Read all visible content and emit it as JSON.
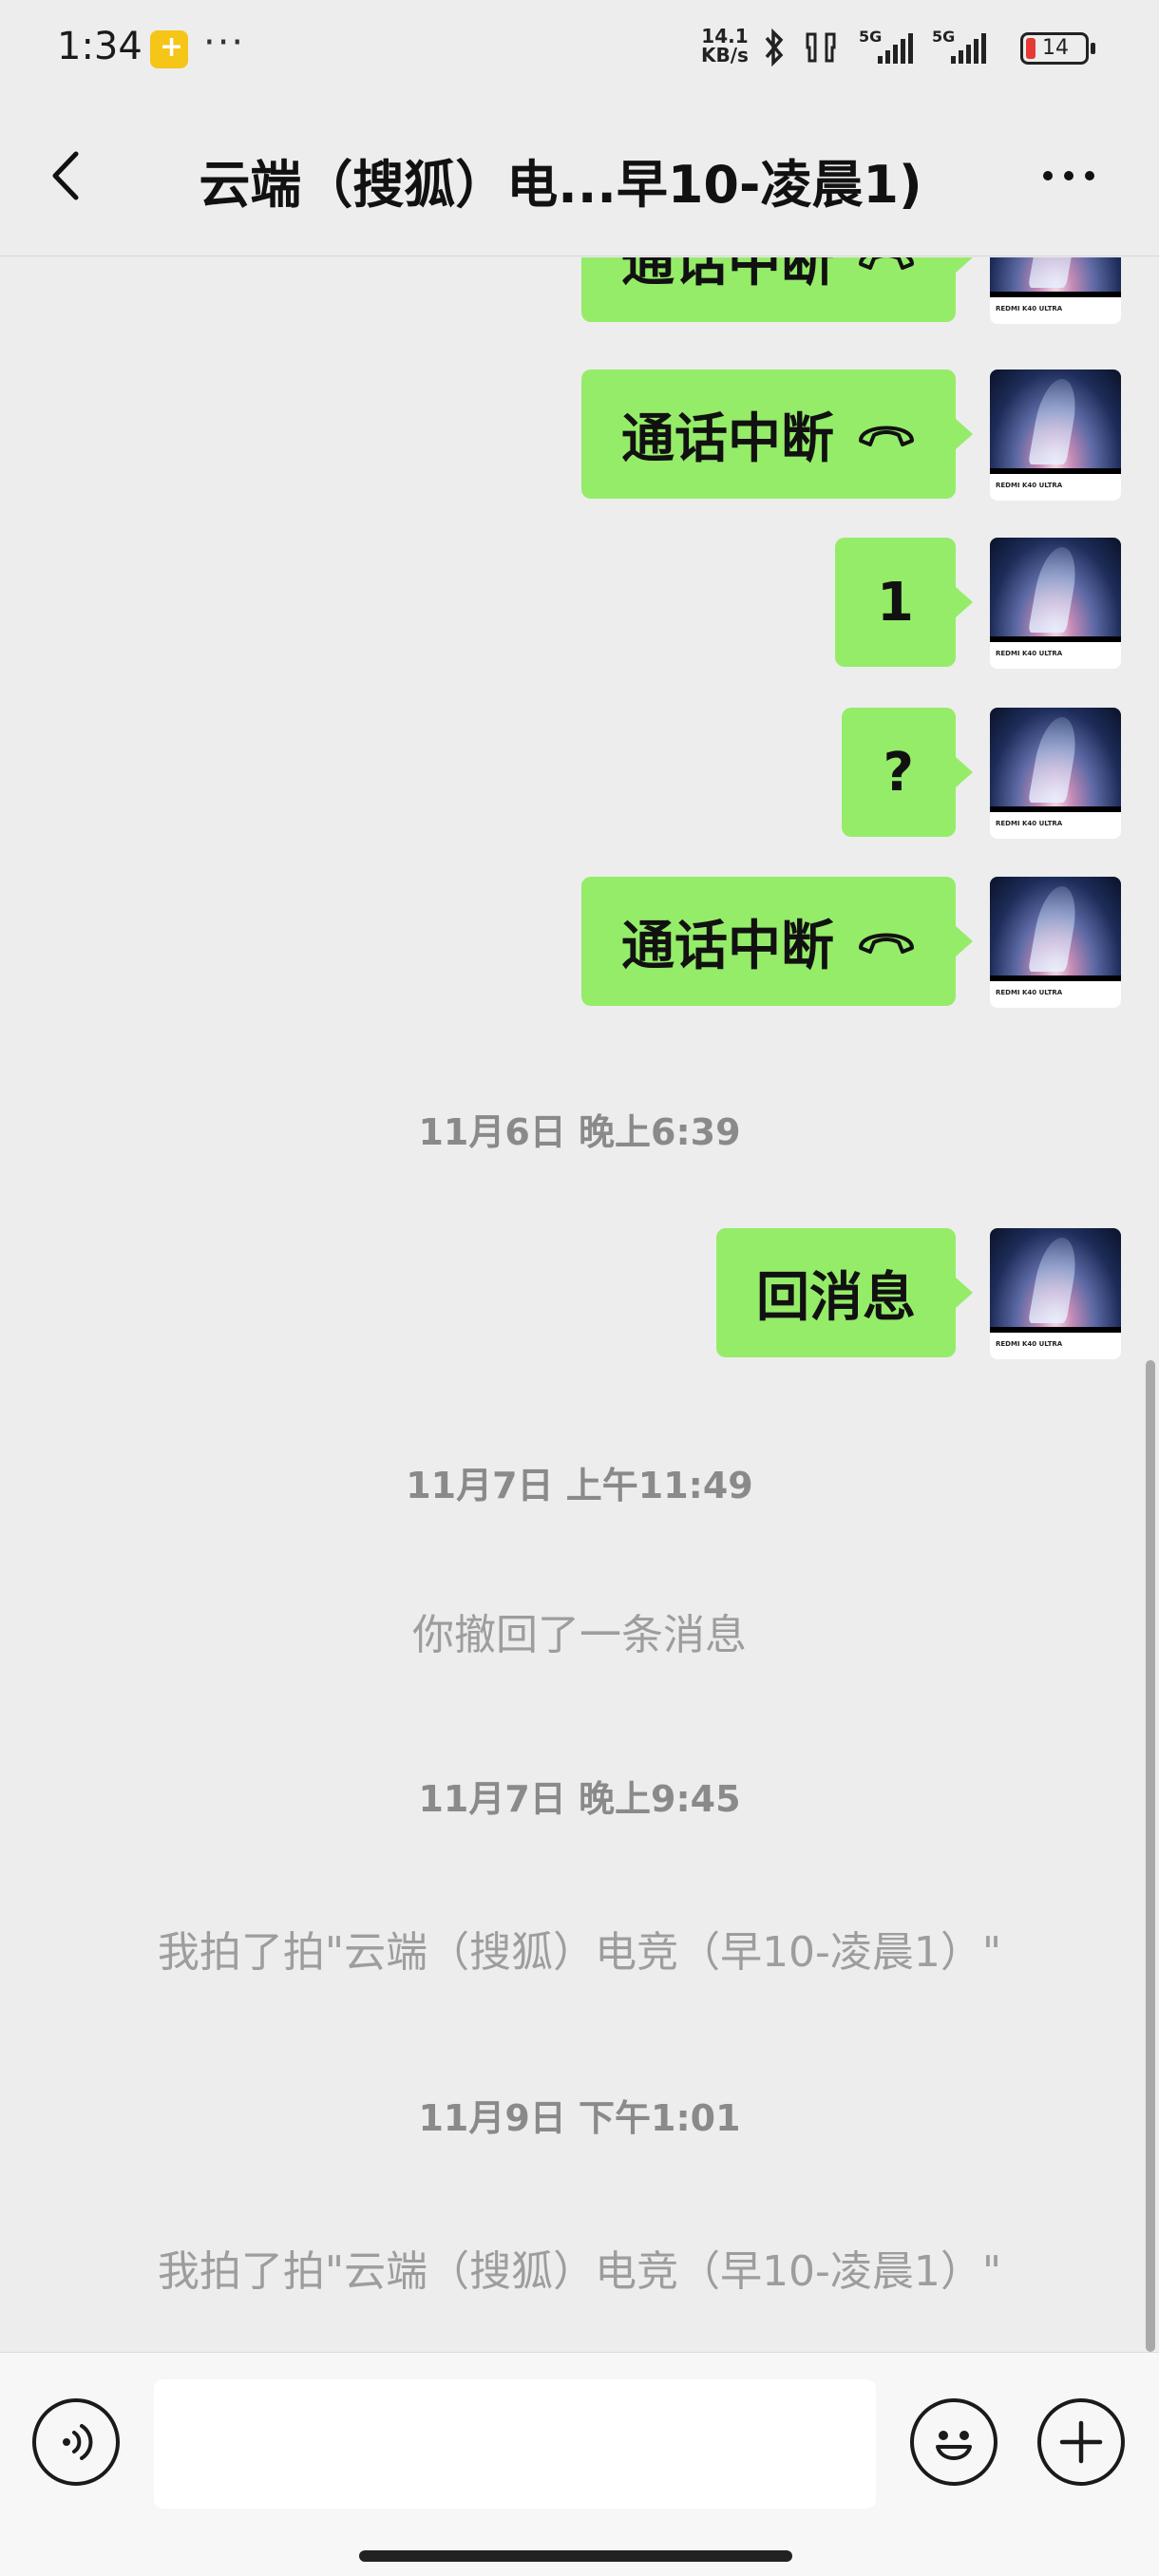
{
  "status_bar": {
    "time": "1:34",
    "dots": "···",
    "speed_top": "14.1",
    "speed_bottom": "KB/s",
    "signal1_label": "5G",
    "signal2_label": "5G",
    "battery": "14",
    "battery_color": "#e53935"
  },
  "header": {
    "title": "云端（搜狐）电...早10-凌晨1)",
    "back_icon": "chevron-left-icon",
    "more_icon": "more-dots-icon"
  },
  "messages": [
    {
      "type": "outgoing",
      "text": "通话中断",
      "icon": "hangup-icon"
    },
    {
      "type": "outgoing",
      "text": "通话中断",
      "icon": "hangup-icon"
    },
    {
      "type": "outgoing",
      "text": "1"
    },
    {
      "type": "outgoing",
      "text": "?"
    },
    {
      "type": "outgoing",
      "text": "通话中断",
      "icon": "hangup-icon"
    },
    {
      "type": "time",
      "text": "11月6日 晚上6:39"
    },
    {
      "type": "outgoing",
      "text": "回消息"
    },
    {
      "type": "time",
      "text": "11月7日 上午11:49"
    },
    {
      "type": "system",
      "text": "你撤回了一条消息"
    },
    {
      "type": "time",
      "text": "11月7日 晚上9:45"
    },
    {
      "type": "system",
      "text": "我拍了拍\"云端（搜狐）电竞（早10-凌晨1）\""
    },
    {
      "type": "time",
      "text": "11月9日 下午1:01"
    },
    {
      "type": "system",
      "text": "我拍了拍\"云端（搜狐）电竞（早10-凌晨1）\""
    }
  ],
  "avatar_caption": "REDMI K40 ULTRA",
  "input_bar": {
    "value": "",
    "voice_icon": "voice-icon",
    "emoji_icon": "emoji-icon",
    "plus_icon": "plus-icon"
  },
  "colors": {
    "bubble": "#95ec69",
    "background": "#ededed",
    "timestamp": "#8a8a8a"
  }
}
